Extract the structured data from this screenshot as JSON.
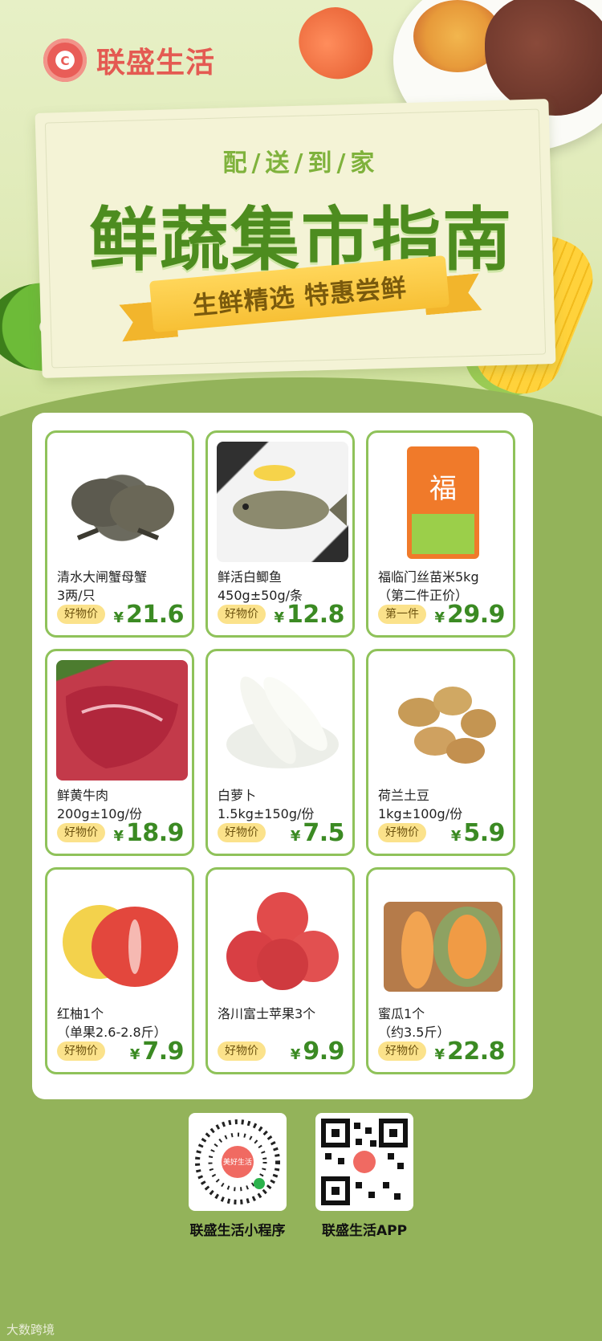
{
  "brand": {
    "name": "联盛生活"
  },
  "banner": {
    "subtitle": "配/送/到/家",
    "title": "鲜蔬集市指南",
    "ribbon": "生鲜精选 特惠尝鲜"
  },
  "colors": {
    "primary_green": "#3b8a23",
    "card_border": "#8fc25a",
    "tag_bg": "#fbe28b",
    "page_bg": "#93b35a"
  },
  "products": [
    {
      "name_line1": "清水大闸蟹母蟹",
      "name_line2": "3两/只",
      "tag": "好物价",
      "currency": "¥",
      "price": "21.6",
      "image": "crab-photo"
    },
    {
      "name_line1": "鲜活白鲫鱼",
      "name_line2": "450g±50g/条",
      "tag": "好物价",
      "currency": "¥",
      "price": "12.8",
      "image": "fish-photo"
    },
    {
      "name_line1": "福临门丝苗米5kg",
      "name_line2": "（第二件正价）",
      "tag": "第一件",
      "currency": "¥",
      "price": "29.9",
      "image": "rice-bag-photo"
    },
    {
      "name_line1": "鲜黄牛肉",
      "name_line2": "200g±10g/份",
      "tag": "好物价",
      "currency": "¥",
      "price": "18.9",
      "image": "beef-photo"
    },
    {
      "name_line1": "白萝卜",
      "name_line2": "1.5kg±150g/份",
      "tag": "好物价",
      "currency": "¥",
      "price": "7.5",
      "image": "radish-photo"
    },
    {
      "name_line1": "荷兰土豆",
      "name_line2": "1kg±100g/份",
      "tag": "好物价",
      "currency": "¥",
      "price": "5.9",
      "image": "potato-photo"
    },
    {
      "name_line1": "红柚1个",
      "name_line2": "（单果2.6-2.8斤）",
      "tag": "好物价",
      "currency": "¥",
      "price": "7.9",
      "image": "pomelo-photo"
    },
    {
      "name_line1": "洛川富士苹果3个",
      "name_line2": "",
      "tag": "好物价",
      "currency": "¥",
      "price": "9.9",
      "image": "apple-photo"
    },
    {
      "name_line1": "蜜瓜1个",
      "name_line2": "（约3.5斤）",
      "tag": "好物价",
      "currency": "¥",
      "price": "22.8",
      "image": "melon-photo"
    }
  ],
  "qr": [
    {
      "label": "联盛生活小程序",
      "center_text": "美好生活"
    },
    {
      "label": "联盛生活APP"
    }
  ],
  "watermark": "大数跨境"
}
